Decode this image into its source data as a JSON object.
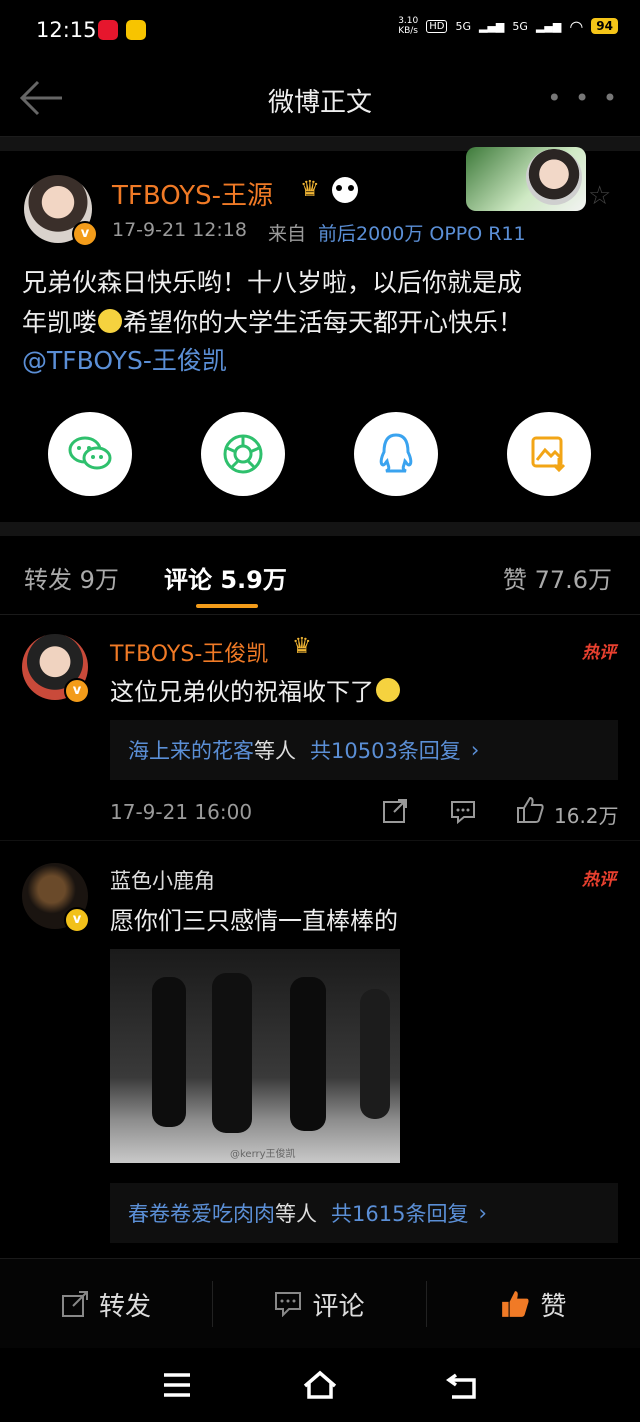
{
  "status_bar": {
    "time": "12:15",
    "speed": "3.10\nKB/s",
    "net1": "HD",
    "net2": "5G",
    "net3": "5G",
    "battery": "94"
  },
  "header": {
    "title": "微博正文"
  },
  "post": {
    "author": "TFBOYS-王源",
    "time": "17-9-21 12:18",
    "source_prefix": "来自",
    "source": "前后2000万 OPPO R11",
    "text_line1": "兄弟伙森日快乐哟！十八岁啦，以后你就是成",
    "text_line2a": "年凯喽",
    "text_line2b": "希望你的大学生活每天都开心快乐！",
    "mention": "@TFBOYS-王俊凯"
  },
  "share": {
    "wechat": "wechat-icon",
    "moments": "moments-icon",
    "qq": "qq-icon",
    "save": "save-image-icon"
  },
  "tabs": {
    "repost_label": "转发",
    "repost_count": "9万",
    "comment_label": "评论",
    "comment_count": "5.9万",
    "like_label": "赞",
    "like_count": "77.6万"
  },
  "comments": [
    {
      "name": "TFBOYS-王俊凯",
      "text": "这位兄弟伙的祝福收下了",
      "hot": "热评",
      "reply_user": "海上来的花客",
      "reply_mid": "等人",
      "reply_count": "共10503条回复",
      "time": "17-9-21 16:00",
      "likes": "16.2万"
    },
    {
      "name": "蓝色小鹿角",
      "text": "愿你们三只感情一直棒棒的",
      "hot": "热评",
      "reply_user": "春卷卷爱吃肉肉",
      "reply_mid": "等人",
      "reply_count": "共1615条回复",
      "image_caption": "@kerry王俊凯"
    }
  ],
  "bottom_bar": {
    "repost": "转发",
    "comment": "评论",
    "like": "赞"
  },
  "colors": {
    "accent_orange": "#f07a26",
    "link_blue": "#5b8fd6",
    "tab_indicator": "#f39c1a"
  }
}
